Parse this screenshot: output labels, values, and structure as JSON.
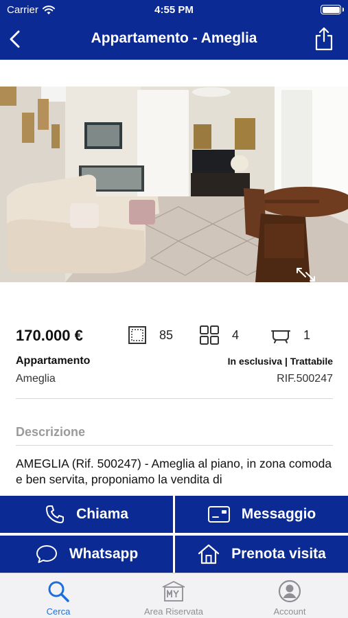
{
  "status_bar": {
    "carrier": "Carrier",
    "time": "4:55 PM"
  },
  "nav": {
    "title": "Appartamento - Ameglia"
  },
  "listing": {
    "price": "170.000 €",
    "surface": "85",
    "rooms": "4",
    "bathrooms": "1",
    "type": "Appartamento",
    "city": "Ameglia",
    "conditions": "In esclusiva | Trattabile",
    "reference": "RIF.500247",
    "description_title": "Descrizione",
    "description": "AMEGLIA (Rif. 500247) - Ameglia al piano, in zona comoda e ben servita, proponiamo la vendita di"
  },
  "actions": {
    "call": "Chiama",
    "message": "Messaggio",
    "whatsapp": "Whatsapp",
    "book_visit": "Prenota visita"
  },
  "tabs": [
    {
      "label": "Cerca",
      "active": true
    },
    {
      "label": "Area Riservata",
      "active": false
    },
    {
      "label": "Account",
      "active": false
    }
  ],
  "colors": {
    "brand": "#0b2a94",
    "tab_active": "#1c6fd6",
    "tab_inactive": "#8e8e93"
  }
}
